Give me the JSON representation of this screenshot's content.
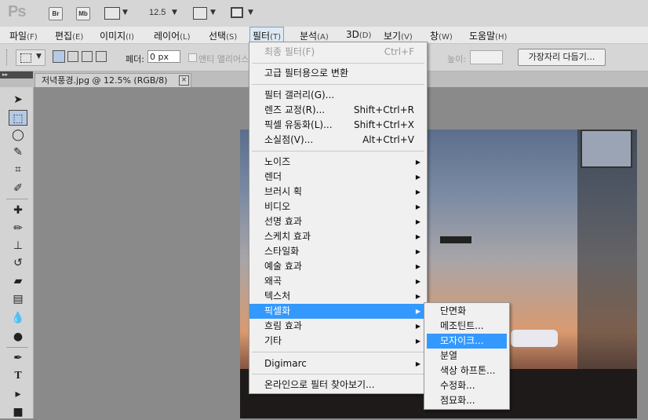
{
  "app": {
    "logo": "Ps",
    "bridge_btn": "Br",
    "minibridge_btn": "Mb",
    "zoom": "12.5"
  },
  "menubar": [
    {
      "label": "파일",
      "key": "(F)"
    },
    {
      "label": "편집",
      "key": "(E)"
    },
    {
      "label": "이미지",
      "key": "(I)"
    },
    {
      "label": "레이어",
      "key": "(L)"
    },
    {
      "label": "선택",
      "key": "(S)"
    },
    {
      "label": "필터",
      "key": "(T)"
    },
    {
      "label": "분석",
      "key": "(A)"
    },
    {
      "label": "3D",
      "key": "(D)"
    },
    {
      "label": "보기",
      "key": "(V)"
    },
    {
      "label": "창",
      "key": "(W)"
    },
    {
      "label": "도움말",
      "key": "(H)"
    }
  ],
  "options": {
    "feather_label": "페더:",
    "feather_value": "0 px",
    "antialias_label": "앤티 앨리어스",
    "height_label": "높이:",
    "refine_edge": "가장자리 다듬기..."
  },
  "document_tab": {
    "title": "저녁풍경.jpg @ 12.5% (RGB/8)",
    "close": "×"
  },
  "filter_menu": {
    "last_filter": {
      "label": "최종 필터(F)",
      "shortcut": "Ctrl+F"
    },
    "convert_smart": "고급 필터용으로 변환",
    "group2": [
      {
        "label": "필터 갤러리(G)...",
        "shortcut": ""
      },
      {
        "label": "렌즈 교정(R)...",
        "shortcut": "Shift+Ctrl+R"
      },
      {
        "label": "픽셀 유동화(L)...",
        "shortcut": "Shift+Ctrl+X"
      },
      {
        "label": "소실점(V)...",
        "shortcut": "Alt+Ctrl+V"
      }
    ],
    "submenus": [
      "노이즈",
      "렌더",
      "브러시 획",
      "비디오",
      "선명 효과",
      "스케치 효과",
      "스타일화",
      "예술 효과",
      "왜곡",
      "텍스처",
      "픽셀화",
      "흐림 효과",
      "기타"
    ],
    "highlighted": "픽셀화",
    "digimarc": "Digimarc",
    "browse_online": "온라인으로 필터 찾아보기..."
  },
  "pixelate_submenu": {
    "items": [
      "단면화",
      "메조틴트...",
      "모자이크...",
      "분열",
      "색상 하프톤...",
      "수정화...",
      "점묘화..."
    ],
    "highlighted": "모자이크..."
  },
  "colors": {
    "menu_highlight": "#3399ff",
    "menu_bg": "#f0f0f0"
  }
}
